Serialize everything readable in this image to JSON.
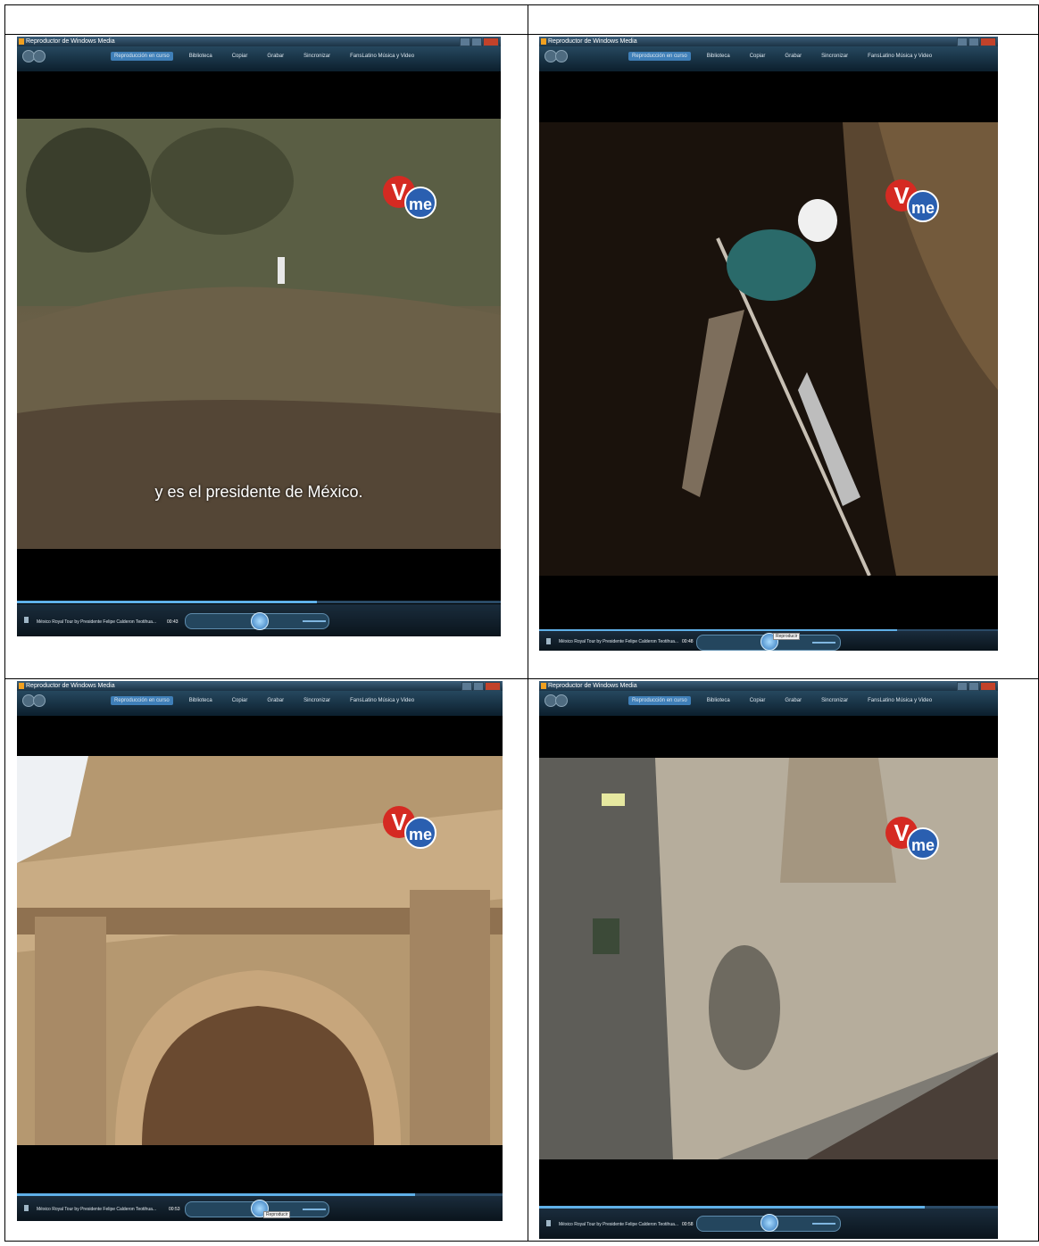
{
  "players": [
    {
      "title": "Reproductor de Windows Media",
      "tabs": [
        "Reproducción en curso",
        "Biblioteca",
        "Copiar",
        "Grabar",
        "Sincronizar",
        "FansLatino Música y Video"
      ],
      "subtitle": "y es el presidente de México.",
      "logo_v": "V",
      "logo_me": "me",
      "track": "México Royal Tour by Presidente Felipe Calderon Teotihua...",
      "time": "00:43"
    },
    {
      "title": "Reproductor de Windows Media",
      "tabs": [
        "Reproducción en curso",
        "Biblioteca",
        "Copiar",
        "Grabar",
        "Sincronizar",
        "FansLatino Música y Video"
      ],
      "subtitle": "",
      "logo_v": "V",
      "logo_me": "me",
      "track": "México Royal Tour by Presidente Felipe Calderon Teotihua...",
      "time": "00:48",
      "tooltip": "Reproducir"
    },
    {
      "title": "Reproductor de Windows Media",
      "tabs": [
        "Reproducción en curso",
        "Biblioteca",
        "Copiar",
        "Grabar",
        "Sincronizar",
        "FansLatino Música y Video"
      ],
      "subtitle": "",
      "logo_v": "V",
      "logo_me": "me",
      "track": "México Royal Tour by Presidente Felipe Calderon Teotihua...",
      "time": "00:53",
      "tooltip": "Reproducir"
    },
    {
      "title": "Reproductor de Windows Media",
      "tabs": [
        "Reproducción en curso",
        "Biblioteca",
        "Copiar",
        "Grabar",
        "Sincronizar",
        "FansLatino Música y Video"
      ],
      "subtitle": "",
      "logo_v": "V",
      "logo_me": "me",
      "track": "México Royal Tour by Presidente Felipe Calderon Teotihua...",
      "time": "00:58"
    }
  ]
}
